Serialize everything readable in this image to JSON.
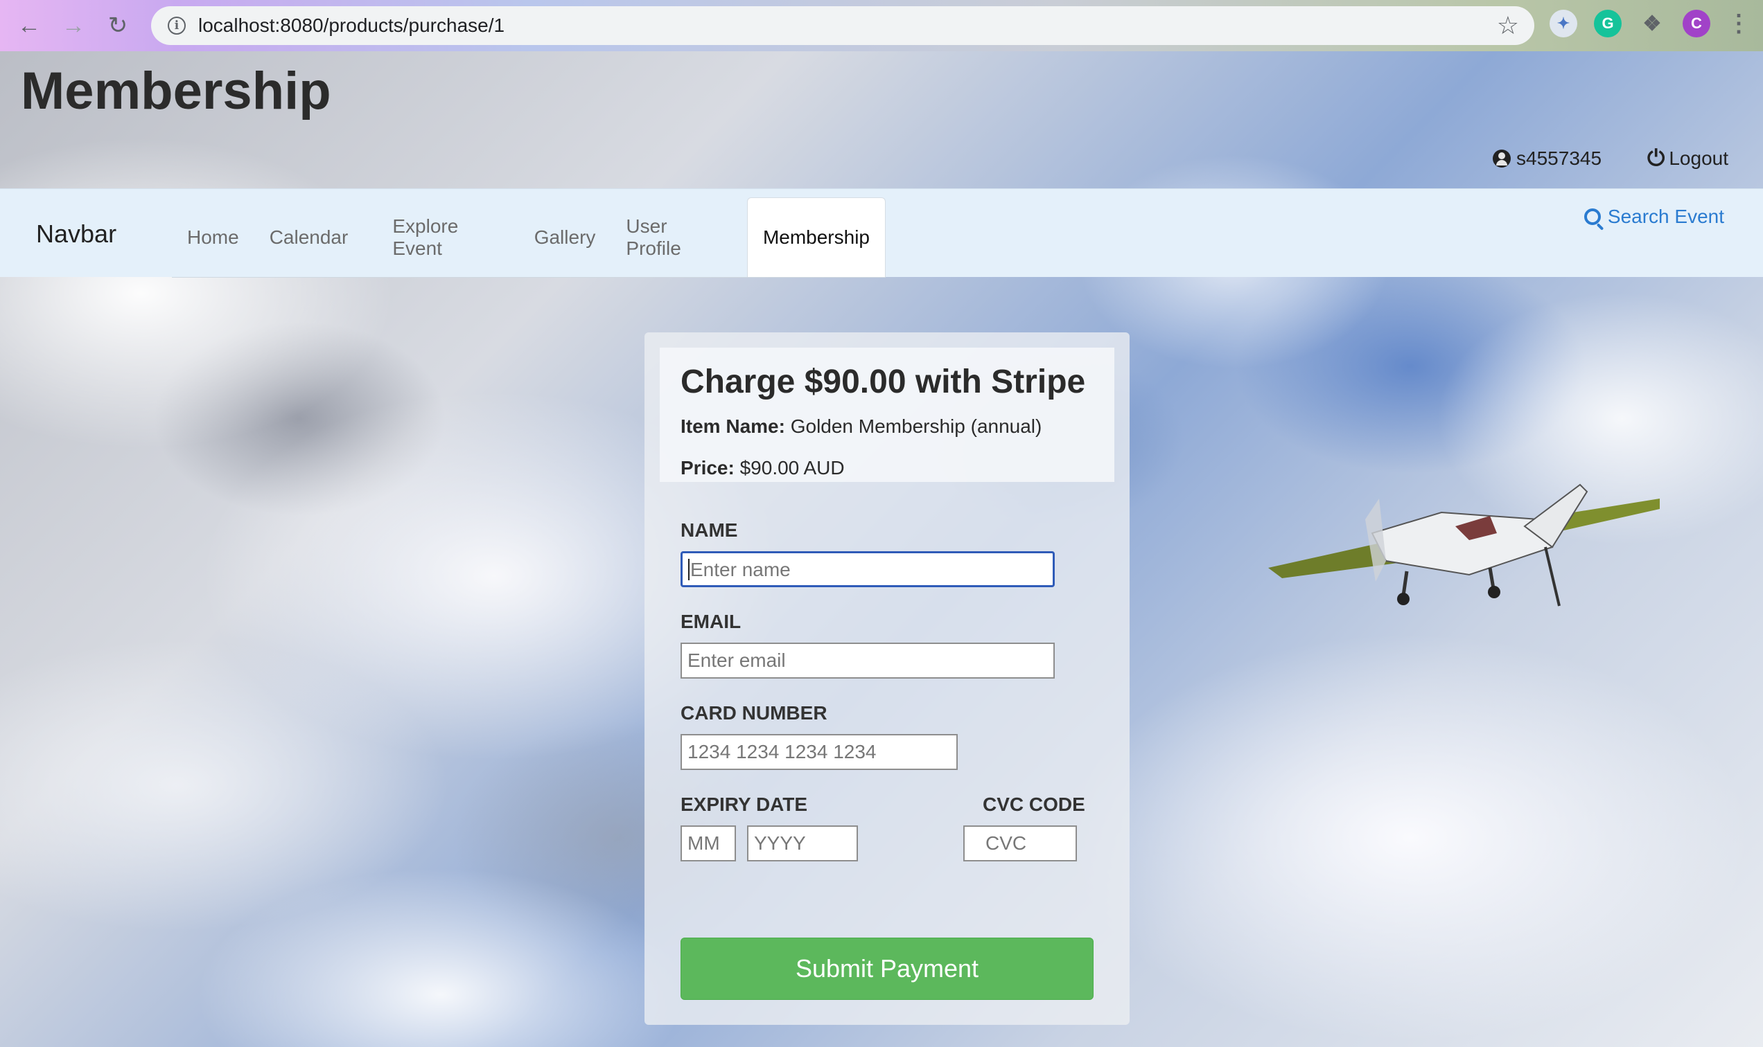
{
  "browser": {
    "url_host": "localhost",
    "url_rest": ":8080/products/purchase/1",
    "back_icon": "arrow-left-icon",
    "forward_icon": "arrow-right-icon",
    "reload_icon": "reload-icon",
    "profile_initial": "C",
    "grammarly_initial": "G"
  },
  "header": {
    "title": "Membership",
    "username": "s4557345",
    "logout_label": "Logout"
  },
  "navbar": {
    "brand": "Navbar",
    "tabs": [
      {
        "label": "Home"
      },
      {
        "label": "Calendar"
      },
      {
        "label": "Explore Event"
      },
      {
        "label": "Gallery"
      },
      {
        "label": "User Profile"
      },
      {
        "label": "Membership"
      }
    ],
    "active_tab": "Membership",
    "search_label": "Search Event"
  },
  "payment": {
    "heading": "Charge $90.00 with Stripe",
    "item_name_label": "Item Name:",
    "item_name_value": "Golden Membership (annual)",
    "price_label": "Price:",
    "price_value": "$90.00 AUD",
    "name_label": "NAME",
    "name_placeholder": "Enter name",
    "email_label": "EMAIL",
    "email_placeholder": "Enter email",
    "card_label": "CARD NUMBER",
    "card_placeholder": "1234 1234 1234 1234",
    "expiry_label": "EXPIRY DATE",
    "month_placeholder": "MM",
    "year_placeholder": "YYYY",
    "cvc_label": "CVC CODE",
    "cvc_placeholder": "CVC",
    "submit_label": "Submit Payment"
  },
  "colors": {
    "submit_green": "#5cb85c",
    "link_blue": "#2a7bd0",
    "navbar_bg": "#e4f0fa",
    "focus_blue": "#2f5bb8"
  }
}
